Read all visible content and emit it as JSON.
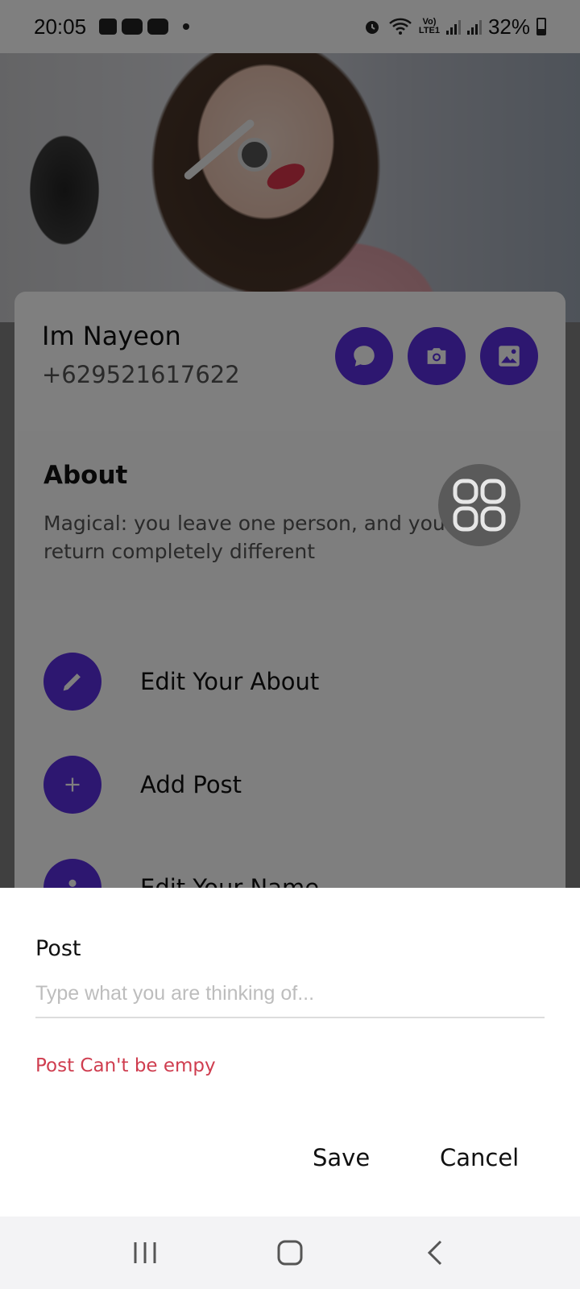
{
  "status_bar": {
    "time": "20:05",
    "battery": "32%",
    "lte_label_top": "Vo)",
    "lte_label_bottom": "LTE1",
    "icons": [
      "gallery-icon",
      "youtube-icon",
      "youtube-icon",
      "alarm-icon",
      "wifi-icon",
      "signal-icon",
      "signal-icon",
      "battery-icon"
    ]
  },
  "profile": {
    "name": "Im Nayeon",
    "phone": "+629521617622",
    "actions": [
      "chat-icon",
      "camera-icon",
      "image-icon"
    ]
  },
  "about": {
    "title": "About",
    "text": "Magical: you leave one person, and you return completely different"
  },
  "menu": [
    {
      "label": "Edit Your About",
      "icon": "pencil-icon"
    },
    {
      "label": "Add Post",
      "icon": "plus-icon"
    },
    {
      "label": "Edit Your Name",
      "icon": "person-icon"
    }
  ],
  "sheet": {
    "title": "Post",
    "input_placeholder": "Type what you are thinking of...",
    "input_value": "",
    "error": "Post Can't be empy",
    "save_label": "Save",
    "cancel_label": "Cancel"
  },
  "colors": {
    "accent": "#5b2fe0",
    "error": "#cf3d4f",
    "scrim": "rgba(0,0,0,0.5)"
  }
}
